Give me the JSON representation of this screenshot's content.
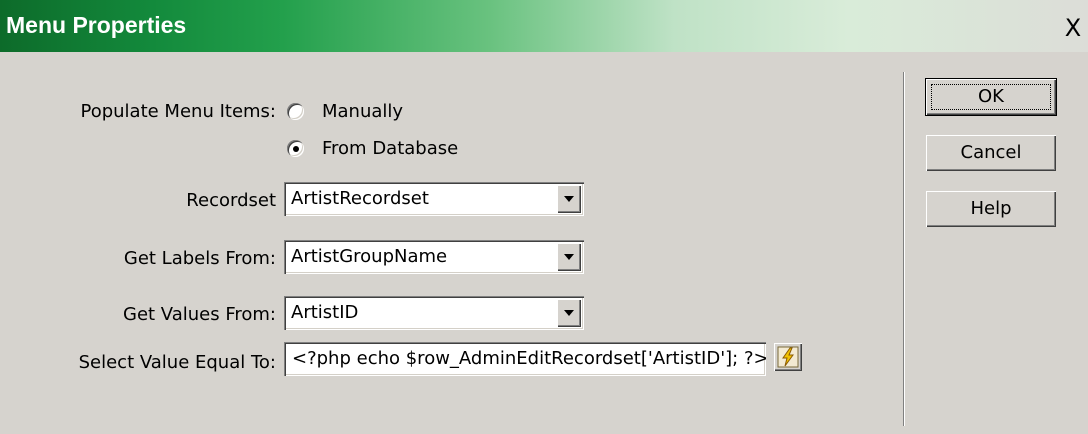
{
  "window": {
    "title": "Menu Properties",
    "close_symbol": "X"
  },
  "populate": {
    "label": "Populate Menu Items:",
    "options": [
      {
        "label": "Manually",
        "selected": false
      },
      {
        "label": "From Database",
        "selected": true
      }
    ]
  },
  "recordset": {
    "label": "Recordset",
    "value": "ArtistRecordset"
  },
  "labels_from": {
    "label": "Get Labels From:",
    "value": "ArtistGroupName"
  },
  "values_from": {
    "label": "Get Values From:",
    "value": "ArtistID"
  },
  "select_value": {
    "label": "Select Value Equal To:",
    "value": "<?php echo $row_AdminEditRecordset['ArtistID']; ?>"
  },
  "icons": {
    "dynamic_data": "lightning-bolt-icon",
    "close": "close-icon",
    "dropdown": "chevron-down-icon"
  },
  "buttons": {
    "ok": "OK",
    "cancel": "Cancel",
    "help": "Help"
  },
  "colors": {
    "title_start": "#0d6b2a",
    "title_end": "#dcddd8",
    "dialog_bg": "#d6d3ce"
  }
}
